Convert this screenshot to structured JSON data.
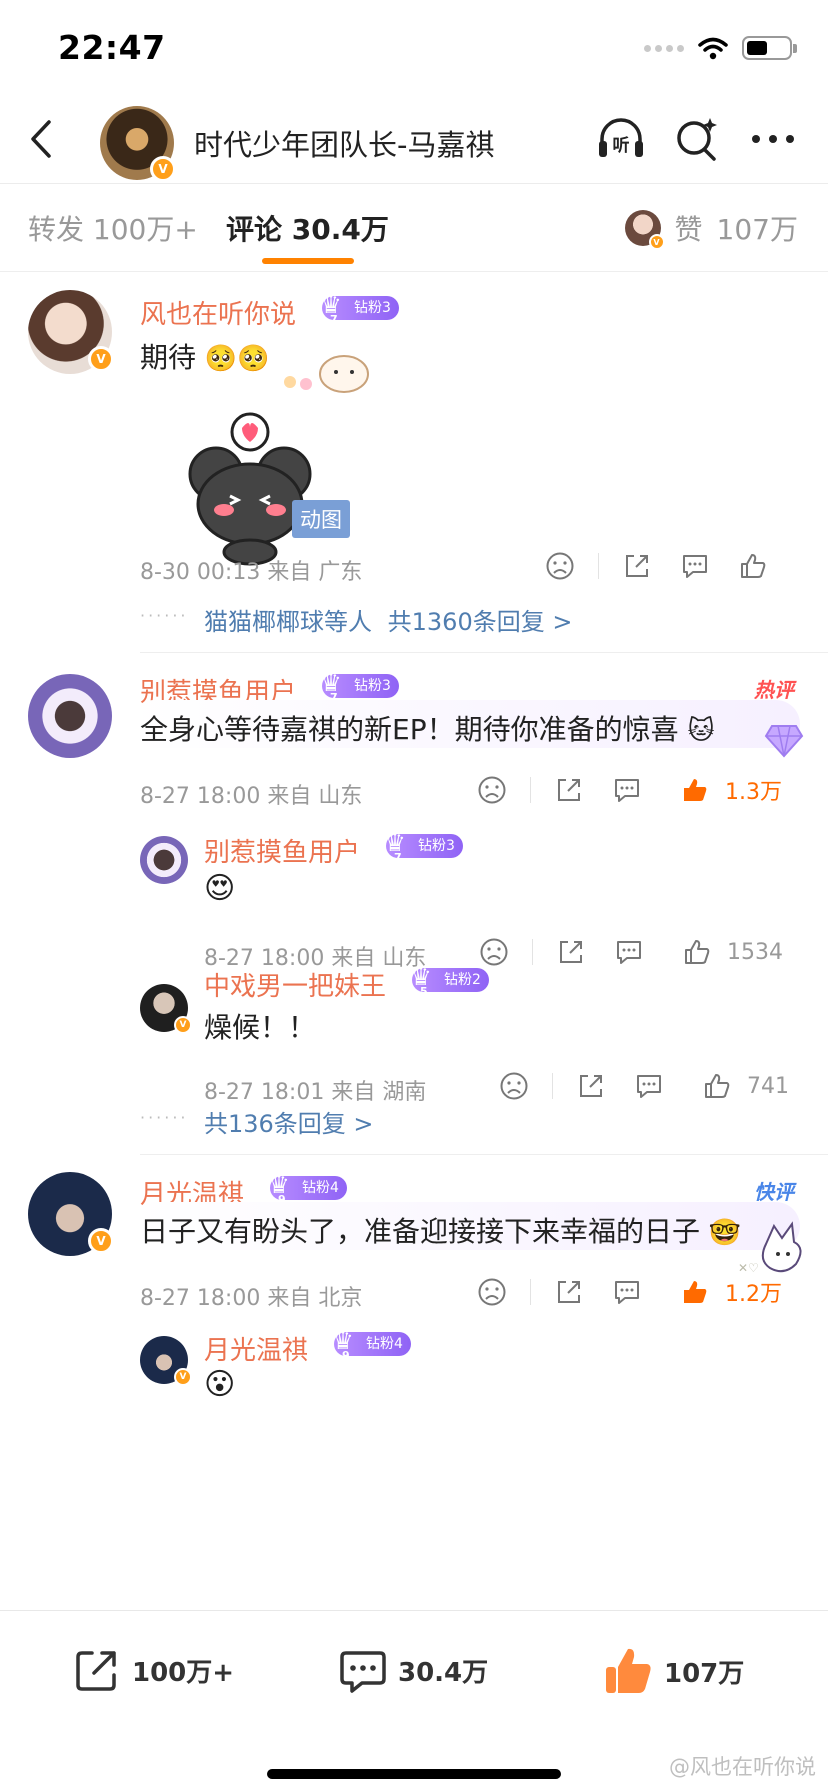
{
  "status_bar": {
    "time": "22:47"
  },
  "header": {
    "title": "时代少年团队长-马嘉祺"
  },
  "tabs": {
    "repost_label": "转发",
    "repost_count": "100万+",
    "comment_label": "评论",
    "comment_count": "30.4万",
    "like_label": "赞",
    "like_count": "107万"
  },
  "comments": [
    {
      "username": "风也在听你说",
      "badge": "钻粉3",
      "badge_level": "7",
      "text": "期待",
      "gif_label": "动图",
      "date": "8-30 00:13",
      "location": "来自 广东",
      "replies_preview": "猫猫椰椰球等人",
      "replies_count": "共1360条回复 >"
    },
    {
      "username": "别惹摸鱼用户",
      "badge": "钻粉3",
      "badge_level": "7",
      "tag": "热评",
      "text": "全身心等待嘉祺的新EP！期待你准备的惊喜",
      "date": "8-27 18:00",
      "location": "来自 山东",
      "likes": "1.3万",
      "replies": [
        {
          "username": "别惹摸鱼用户",
          "badge": "钻粉3",
          "badge_level": "7",
          "text": "",
          "date": "8-27 18:00",
          "location": "来自 山东",
          "likes": "1534"
        },
        {
          "username": "中戏男一把妹王",
          "badge": "钻粉2",
          "badge_level": "5",
          "text": "燥候！！",
          "date": "8-27 18:01",
          "location": "来自 湖南",
          "likes": "741"
        }
      ],
      "replies_count": "共136条回复 >"
    },
    {
      "username": "月光温祺",
      "badge": "钻粉4",
      "badge_level": "9",
      "tag": "快评",
      "text": "日子又有盼头了，准备迎接接下来幸福的日子",
      "date": "8-27 18:00",
      "location": "来自 北京",
      "likes": "1.2万",
      "replies": [
        {
          "username": "月光温祺",
          "badge": "钻粉4",
          "badge_level": "9",
          "text": ""
        }
      ]
    }
  ],
  "bottom_bar": {
    "repost_count": "100万+",
    "comment_count": "30.4万",
    "like_count": "107万"
  },
  "watermark": "@风也在听你说",
  "colors": {
    "accent": "#ff8200",
    "username": "#eb7350",
    "link": "#507daf",
    "hot_like": "#ff6a00"
  },
  "icons": [
    "back-arrow-icon",
    "listen-icon",
    "search-sparkle-icon",
    "more-icon",
    "dislike-icon",
    "share-icon",
    "comment-icon",
    "like-icon"
  ]
}
